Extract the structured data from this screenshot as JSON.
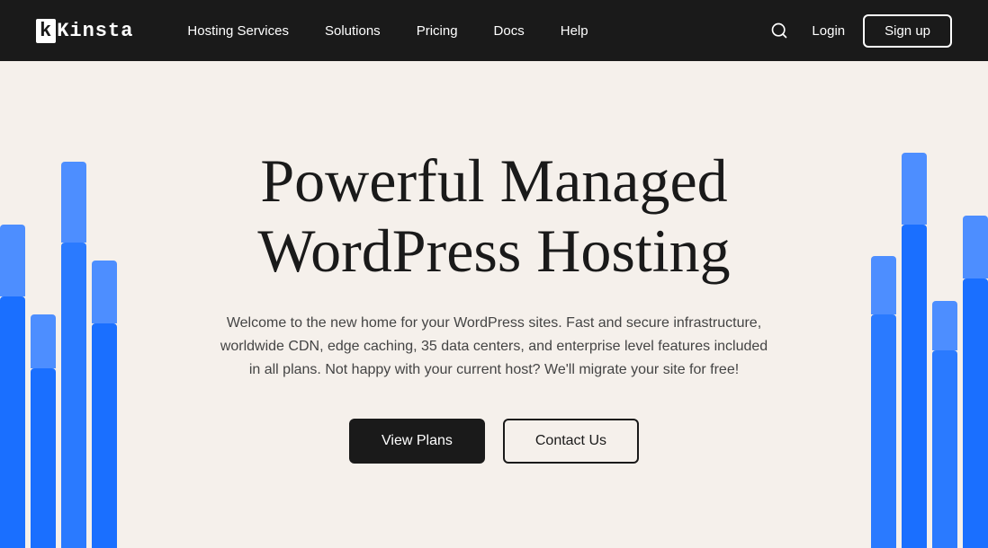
{
  "navbar": {
    "logo": "Kinsta",
    "links": [
      {
        "label": "Hosting Services",
        "id": "hosting-services"
      },
      {
        "label": "Solutions",
        "id": "solutions"
      },
      {
        "label": "Pricing",
        "id": "pricing"
      },
      {
        "label": "Docs",
        "id": "docs"
      },
      {
        "label": "Help",
        "id": "help"
      }
    ],
    "login_label": "Login",
    "signup_label": "Sign up"
  },
  "hero": {
    "title": "Powerful Managed WordPress Hosting",
    "subtitle": "Welcome to the new home for your WordPress sites. Fast and secure infrastructure, worldwide CDN, edge caching, 35 data centers, and enterprise level features included in all plans. Not happy with your current host? We'll migrate your site for free!",
    "btn_primary": "View Plans",
    "btn_secondary": "Contact Us"
  },
  "colors": {
    "navbar_bg": "#1a1a1a",
    "hero_bg": "#f5f0eb",
    "blue_block": "#1a6fff",
    "blue_block_light": "#4d8eff"
  }
}
